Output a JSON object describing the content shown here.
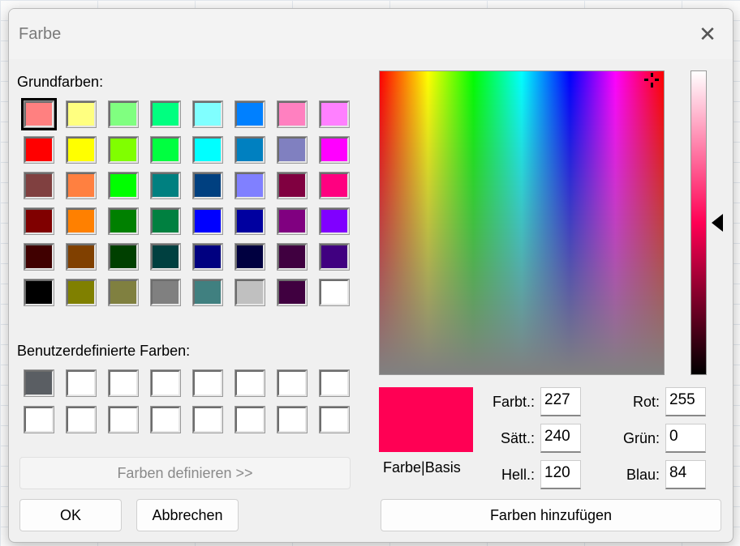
{
  "title": "Farbe",
  "basic_label": "Grundfarben:",
  "custom_label": "Benutzerdefinierte Farben:",
  "basic_colors": [
    "#ff8080",
    "#ffff80",
    "#80ff80",
    "#00ff80",
    "#80ffff",
    "#0080ff",
    "#ff80c0",
    "#ff80ff",
    "#ff0000",
    "#ffff00",
    "#80ff00",
    "#00ff40",
    "#00ffff",
    "#0080c0",
    "#8080c0",
    "#ff00ff",
    "#804040",
    "#ff8040",
    "#00ff00",
    "#008080",
    "#004080",
    "#8080ff",
    "#800040",
    "#ff0080",
    "#800000",
    "#ff8000",
    "#008000",
    "#008040",
    "#0000ff",
    "#0000a0",
    "#800080",
    "#8000ff",
    "#400000",
    "#804000",
    "#004000",
    "#004040",
    "#000080",
    "#000040",
    "#400040",
    "#400080",
    "#000000",
    "#808000",
    "#808040",
    "#808080",
    "#408080",
    "#c0c0c0",
    "#400040",
    "#ffffff"
  ],
  "selected_basic_index": 0,
  "custom_colors": [
    "#5a5e63",
    "#ffffff",
    "#ffffff",
    "#ffffff",
    "#ffffff",
    "#ffffff",
    "#ffffff",
    "#ffffff",
    "#ffffff",
    "#ffffff",
    "#ffffff",
    "#ffffff",
    "#ffffff",
    "#ffffff",
    "#ffffff",
    "#ffffff"
  ],
  "define_button": "Farben definieren >>",
  "ok_button": "OK",
  "cancel_button": "Abbrechen",
  "add_button": "Farben hinzufügen",
  "preview_label": "Farbe|Basis",
  "current_color": "#ff0054",
  "fields": {
    "hue_label": "Farbt.:",
    "hue": "227",
    "sat_label": "Sätt.:",
    "sat": "240",
    "lum_label": "Hell.:",
    "lum": "120",
    "red_label": "Rot:",
    "red": "255",
    "green_label": "Grün:",
    "green": "0",
    "blue_label": "Blau:",
    "blue": "84"
  }
}
